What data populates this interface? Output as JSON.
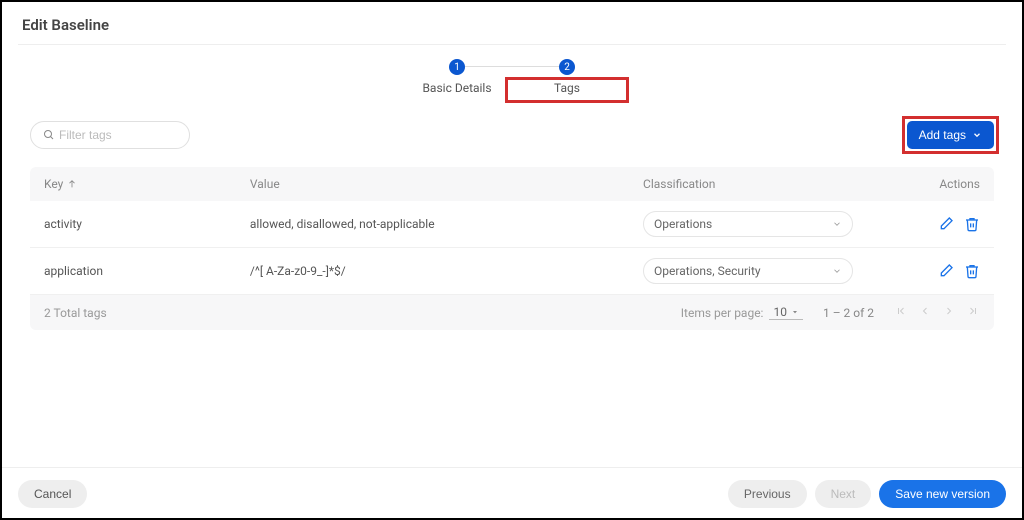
{
  "page_title": "Edit Baseline",
  "stepper": {
    "steps": [
      {
        "num": "1",
        "label": "Basic Details"
      },
      {
        "num": "2",
        "label": "Tags"
      }
    ],
    "active_index": 1
  },
  "toolbar": {
    "filter_placeholder": "Filter tags",
    "add_tags_label": "Add tags"
  },
  "table": {
    "headers": {
      "key": "Key",
      "value": "Value",
      "classification": "Classification",
      "actions": "Actions"
    },
    "sort_column": "key",
    "sort_dir": "asc",
    "rows": [
      {
        "key": "activity",
        "value": "allowed, disallowed, not-applicable",
        "classification": "Operations"
      },
      {
        "key": "application",
        "value": "/^[ A-Za-z0-9_-]*$/",
        "classification": "Operations, Security"
      }
    ],
    "footer": {
      "total_label": "2 Total tags",
      "items_per_page_label": "Items per page:",
      "items_per_page_value": "10",
      "range_label": "1 – 2 of 2"
    }
  },
  "footer": {
    "cancel": "Cancel",
    "previous": "Previous",
    "next": "Next",
    "save": "Save new version"
  },
  "colors": {
    "primary": "#0b57d0",
    "highlight": "#d32f2f"
  }
}
